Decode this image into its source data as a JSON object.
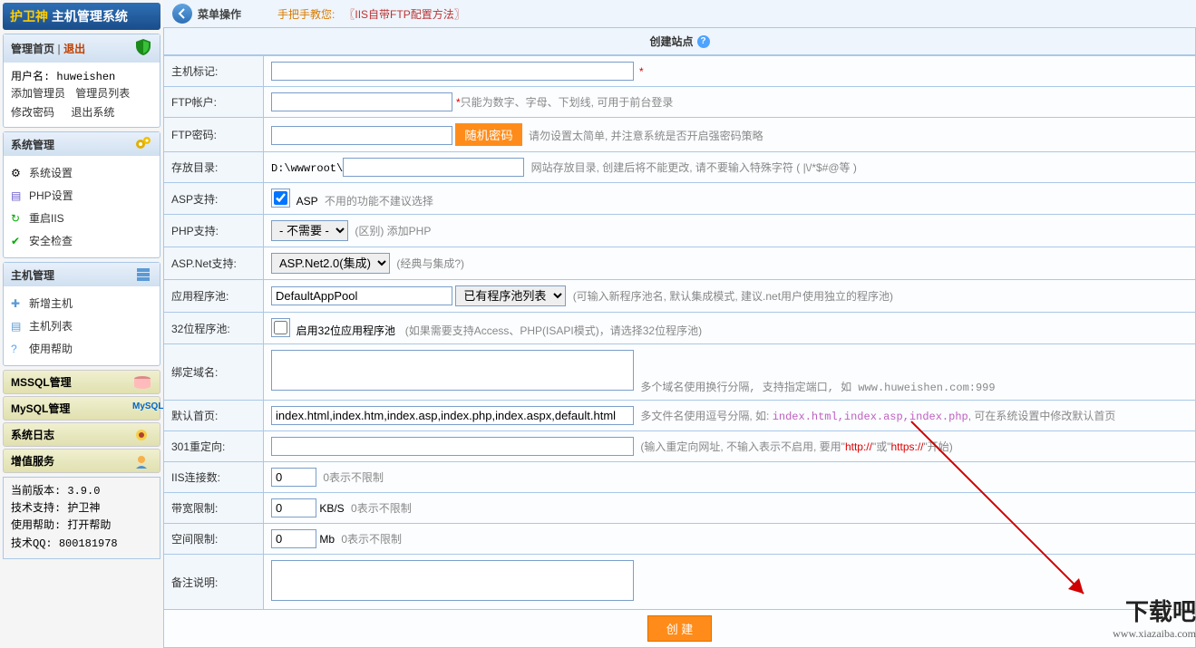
{
  "brand": {
    "name1": "护卫神",
    "name2": "主机管理系统"
  },
  "nav": {
    "home": "管理首页",
    "logout": "退出",
    "user_label": "用户名:",
    "user": "huweishen",
    "add_admin": "添加管理员",
    "admin_list": "管理员列表",
    "change_pwd": "修改密码",
    "exit_sys": "退出系统"
  },
  "sys": {
    "title": "系统管理",
    "items": [
      "系统设置",
      "PHP设置",
      "重启IIS",
      "安全检查"
    ]
  },
  "host": {
    "title": "主机管理",
    "items": [
      "新增主机",
      "主机列表",
      "使用帮助"
    ]
  },
  "bars": {
    "mssql": "MSSQL管理",
    "mysql": "MySQL管理",
    "syslog": "系统日志",
    "vas": "增值服务"
  },
  "info": {
    "ver_label": "当前版本:",
    "ver": "3.9.0",
    "support_label": "技术支持:",
    "support": "护卫神",
    "help_label": "使用帮助:",
    "help": "打开帮助",
    "qq_label": "技术QQ:",
    "qq": "800181978"
  },
  "top": {
    "menu_op": "菜单操作",
    "tip_prefix": "手把手教您:",
    "tip_body": "〖IIS自带FTP配置方法〗"
  },
  "page_title": "创建站点",
  "form": {
    "host_tag": {
      "label": "主机标记:"
    },
    "ftp_user": {
      "label": "FTP帐户:",
      "hint": "只能为数字、字母、下划线, 可用于前台登录"
    },
    "ftp_pwd": {
      "label": "FTP密码:",
      "btn": "随机密码",
      "hint": "请勿设置太简单, 并注意系统是否开启强密码策略"
    },
    "dir": {
      "label": "存放目录:",
      "prefix": "D:\\wwwroot\\",
      "hint": "网站存放目录, 创建后将不能更改, 请不要输入特殊字符 ( |\\/*$#@等 )"
    },
    "asp": {
      "label": "ASP支持:",
      "text": "ASP",
      "hint": "不用的功能不建议选择"
    },
    "php": {
      "label": "PHP支持:",
      "options": [
        "- 不需要 -"
      ],
      "hint": "(区别) 添加PHP"
    },
    "aspnet": {
      "label": "ASP.Net支持:",
      "options": [
        "ASP.Net2.0(集成)"
      ],
      "hint": "(经典与集成?)"
    },
    "apppool": {
      "label": "应用程序池:",
      "value": "DefaultAppPool",
      "select": "已有程序池列表",
      "hint": "(可输入新程序池名, 默认集成模式, 建议.net用户使用独立的程序池)"
    },
    "pool32": {
      "label": "32位程序池:",
      "text": "启用32位应用程序池",
      "hint": "(如果需要支持Access、PHP(ISAPI模式)，请选择32位程序池)"
    },
    "domain": {
      "label": "绑定域名:",
      "hint": "多个域名使用换行分隔, 支持指定端口, 如 www.huweishen.com:999"
    },
    "default_page": {
      "label": "默认首页:",
      "value": "index.html,index.htm,index.asp,index.php,index.aspx,default.html",
      "hint_a": "多文件名使用逗号分隔, 如: ",
      "hint_code": "index.html,index.asp,index.php",
      "hint_b": ", 可在系统设置中修改默认首页"
    },
    "redirect": {
      "label": "301重定向:",
      "hint_a": "(输入重定向网址, 不输入表示不启用, 要用\"",
      "http": "http://",
      "hint_b": "\"或\"",
      "https": "https://",
      "hint_c": "\"开始)"
    },
    "iis_conn": {
      "label": "IIS连接数:",
      "value": "0",
      "hint": "0表示不限制"
    },
    "bw": {
      "label": "带宽限制:",
      "value": "0",
      "unit": "KB/S",
      "hint": "0表示不限制"
    },
    "space": {
      "label": "空间限制:",
      "value": "0",
      "unit": "Mb",
      "hint": "0表示不限制"
    },
    "remark": {
      "label": "备注说明:"
    },
    "submit": "创 建"
  },
  "watermark": {
    "big": "下载吧",
    "url": "www.xiazaiba.com"
  }
}
